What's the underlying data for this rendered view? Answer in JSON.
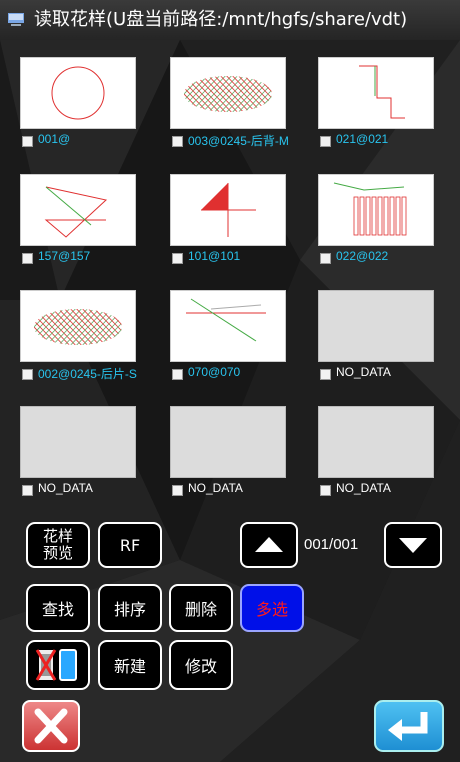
{
  "window": {
    "title": "读取花样(U盘当前路径:/mnt/hgfs/share/vdt)"
  },
  "patterns": [
    {
      "label": "001@",
      "has_data": true,
      "icon": "circle-pattern"
    },
    {
      "label": "003@0245-后背-M",
      "has_data": true,
      "icon": "crosshatch-pattern"
    },
    {
      "label": "021@021",
      "has_data": true,
      "icon": "step-line-pattern"
    },
    {
      "label": "157@157",
      "has_data": true,
      "icon": "triangle-lines-pattern"
    },
    {
      "label": "101@101",
      "has_data": true,
      "icon": "cross-fill-pattern"
    },
    {
      "label": "022@022",
      "has_data": true,
      "icon": "vertical-bars-pattern"
    },
    {
      "label": "002@0245-后片-S",
      "has_data": true,
      "icon": "crosshatch-pattern"
    },
    {
      "label": "070@070",
      "has_data": true,
      "icon": "diagonal-lines-pattern"
    },
    {
      "label": "NO_DATA",
      "has_data": false
    },
    {
      "label": "NO_DATA",
      "has_data": false
    },
    {
      "label": "NO_DATA",
      "has_data": false
    },
    {
      "label": "NO_DATA",
      "has_data": false
    }
  ],
  "buttons": {
    "preview_line1": "花样",
    "preview_line2": "预览",
    "rf": "RF",
    "find": "查找",
    "sort": "排序",
    "delete": "删除",
    "multi_select": "多选",
    "new": "新建",
    "modify": "修改"
  },
  "pagination": {
    "page": "001/001"
  },
  "colors": {
    "label": "#29c4ee",
    "stitch": "#e03030",
    "multi_bg": "#0010e8",
    "multi_text": "#ff1a1a"
  }
}
